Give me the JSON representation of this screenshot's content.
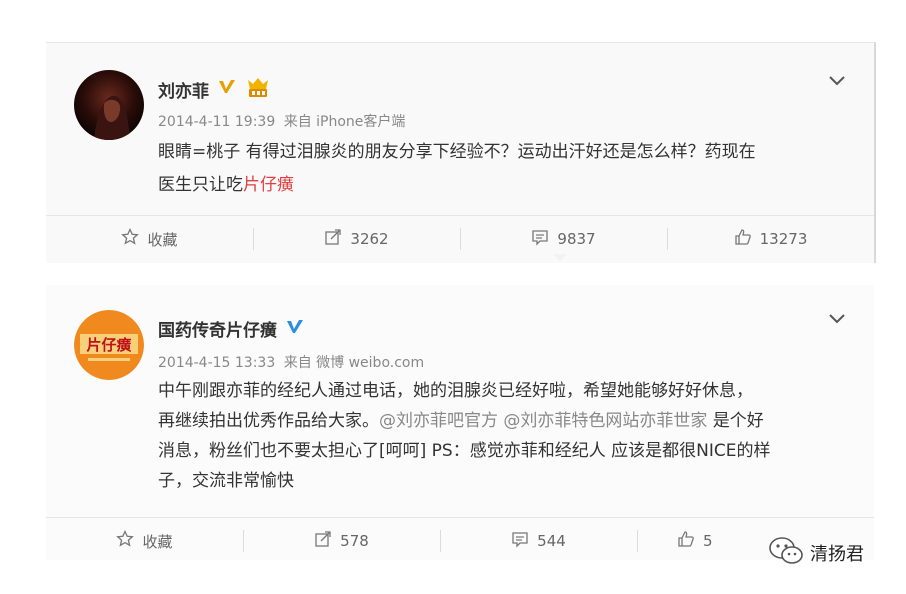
{
  "posts": [
    {
      "author": "刘亦菲",
      "timestamp": "2014-4-11 19:39",
      "source": "来自 iPhone客户端",
      "text_line1": "眼睛=桃子 有得过泪腺炎的朋友分享下经验不？运动出汗好还是怎么样？药现在",
      "text_line2_prefix": "医生只让吃",
      "text_line2_highlight": "片仔癀",
      "actions": {
        "favorite": "收藏",
        "repost": "3262",
        "comment": "9837",
        "like": "13273"
      }
    },
    {
      "author": "国药传奇片仔癀",
      "avatar_text": "片仔癀",
      "timestamp": "2014-4-15 13:33",
      "source": "来自 微博 weibo.com",
      "text_line1": "中午刚跟亦菲的经纪人通过电话，她的泪腺炎已经好啦，希望她能够好好休息，",
      "text_line2_prefix": "再继续拍出优秀作品给大家。",
      "mention1": "@刘亦菲吧官方",
      "mention2": "@刘亦菲特色网站亦菲世家",
      "text_line2_suffix": " 是个好",
      "text_line3": "消息，粉丝们也不要太担心了[呵呵] PS：感觉亦菲和经纪人 应该是都很NICE的样",
      "text_line4": "子，交流非常愉快",
      "actions": {
        "favorite": "收藏",
        "repost": "578",
        "comment": "544",
        "like": "5"
      }
    }
  ],
  "watermark": "清扬君",
  "colors": {
    "highlight": "#e04040",
    "verified_gold": "#e6a100",
    "verified_blue": "#2a8ddf",
    "avatar_orange": "#f08a1e"
  }
}
